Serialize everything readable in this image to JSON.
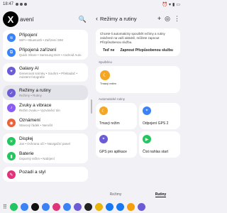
{
  "status": {
    "time": "18:47"
  },
  "left": {
    "title": "avení",
    "groups": [
      [
        {
          "title": "Připojení",
          "sub": "WiFi • Bluetooth • Zařízení SIM",
          "color": "#3b82f6",
          "icon": "wifi-icon"
        },
        {
          "title": "Připojená zařízení",
          "sub": "Quick Share • Samsung DeX • Android Auto",
          "color": "#3b82f6",
          "icon": "devices-icon"
        }
      ],
      [
        {
          "title": "Galaxy AI",
          "sub": "Generovat snímky • Souhrn • Překladač • Asistent fotografie",
          "color": "#6b5bd6",
          "icon": "ai-icon"
        }
      ],
      [
        {
          "title": "Režimy a rutiny",
          "sub": "Režimy • Rutiny",
          "color": "#6b5bd6",
          "icon": "routine-icon",
          "selected": true
        },
        {
          "title": "Zvuky a vibrace",
          "sub": "Režim zvuku • Vyzváněcí tón",
          "color": "#8b5cf6",
          "icon": "sound-icon"
        },
        {
          "title": "Oznámení",
          "sub": "Stavový řádek • Nerušit",
          "color": "#e8633a",
          "icon": "notification-icon"
        }
      ],
      [
        {
          "title": "Displej",
          "sub": "Jas • Ochrana očí • Navigační panel",
          "color": "#22c55e",
          "icon": "display-icon"
        },
        {
          "title": "Baterie",
          "sub": "Úsporný režim • Nabíjení",
          "color": "#22c55e",
          "icon": "battery-icon"
        }
      ],
      [
        {
          "title": "Pozadí a styl",
          "sub": "",
          "color": "#e0337a",
          "icon": "palette-icon"
        }
      ]
    ]
  },
  "right": {
    "title": "Režimy a rutiny",
    "info": "Chcete-li automaticky spouštět režimy a rutiny založené na vaší aktivitě, můžete zapnout Přizpůsobenou službu.",
    "info_left": "Teď ne",
    "info_right": "Zapnout Přizpůsobenou službu",
    "running_label": "Spuštěno",
    "running_item": "Tmavý režim",
    "auto_label": "Automatické rutiny",
    "tiles": [
      {
        "label": "Tmavý režim",
        "color": "#f5a623",
        "icon": "moon-icon"
      },
      {
        "label": "Odpojení GPS 2",
        "color": "#3b82f6",
        "icon": "location-icon"
      },
      {
        "label": "GPS pro aplikace",
        "color": "#6b5bd6",
        "icon": "gps-icon"
      },
      {
        "label": "Číst nahlas start",
        "color": "#22c55e",
        "icon": "read-icon"
      }
    ],
    "tab_modes": "Režimy",
    "tab_routines": "Rutiny"
  },
  "taskbar": {
    "apps": [
      {
        "name": "phone",
        "color": "#22c55e"
      },
      {
        "name": "messages",
        "color": "#3b82f6"
      },
      {
        "name": "app-1",
        "color": "#111"
      },
      {
        "name": "app-2",
        "color": "#3b82f6"
      },
      {
        "name": "app-3",
        "color": "#e0337a"
      },
      {
        "name": "app-4",
        "color": "#3b82f6"
      },
      {
        "name": "app-5",
        "color": "#6b5bd6"
      },
      {
        "name": "app-6",
        "color": "#222"
      },
      {
        "name": "chrome",
        "color": "#eab308"
      },
      {
        "name": "facebook",
        "color": "#1877f2"
      },
      {
        "name": "facebook-2",
        "color": "#1877f2"
      },
      {
        "name": "app-7",
        "color": "#f59e0b"
      },
      {
        "name": "app-8",
        "color": "#6b5bd6"
      }
    ]
  }
}
